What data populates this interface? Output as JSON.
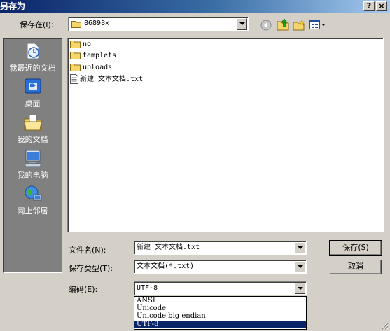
{
  "window": {
    "title": "另存为",
    "help_label": "?",
    "close_label": "×"
  },
  "lookin": {
    "label": "保存在(I):",
    "value": "86898x"
  },
  "places": [
    {
      "label": "我最近的文档",
      "icon": "recent-documents-icon"
    },
    {
      "label": "桌面",
      "icon": "desktop-icon"
    },
    {
      "label": "我的文档",
      "icon": "my-documents-icon"
    },
    {
      "label": "我的电脑",
      "icon": "my-computer-icon"
    },
    {
      "label": "网上邻居",
      "icon": "network-places-icon"
    }
  ],
  "files": [
    {
      "name": "no",
      "type": "folder"
    },
    {
      "name": "templets",
      "type": "folder"
    },
    {
      "name": "uploads",
      "type": "folder"
    },
    {
      "name": "新建 文本文档.txt",
      "type": "text"
    }
  ],
  "form": {
    "filename_label": "文件名(N):",
    "filename_value": "新建 文本文档.txt",
    "filetype_label": "保存类型(T):",
    "filetype_value": "文本文档(*.txt)",
    "encoding_label": "编码(E):",
    "encoding_value": "UTF-8"
  },
  "buttons": {
    "save": "保存(S)",
    "cancel": "取消"
  },
  "encoding_options": [
    "ANSI",
    "Unicode",
    "Unicode big endian",
    "UTF-8"
  ],
  "colors": {
    "titlebar": "#0a246a",
    "face": "#d4d0c8",
    "places_bg": "#808080",
    "selection": "#0a246a"
  }
}
